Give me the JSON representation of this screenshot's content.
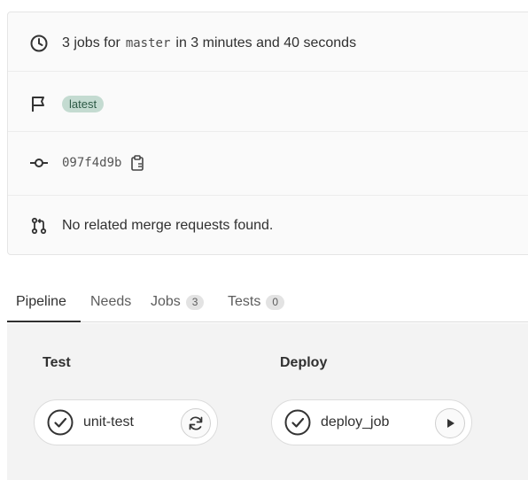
{
  "summary": {
    "jobs_prefix": "3 jobs for",
    "branch": "master",
    "duration_text": "in 3 minutes and 40 seconds",
    "badge": "latest",
    "commit_sha": "097f4d9b",
    "merge_requests_text": "No related merge requests found."
  },
  "tabs": [
    {
      "label": "Pipeline",
      "active": true
    },
    {
      "label": "Needs"
    },
    {
      "label": "Jobs",
      "count": "3"
    },
    {
      "label": "Tests",
      "count": "0"
    }
  ],
  "stages": [
    {
      "title": "Test",
      "job": {
        "name": "unit-test",
        "status": "success",
        "action": "retry"
      }
    },
    {
      "title": "Deploy",
      "job": {
        "name": "deploy_job",
        "status": "success",
        "action": "play"
      }
    }
  ],
  "icons": {
    "clock": "clock-icon",
    "flag": "flag-icon",
    "commit": "commit-icon",
    "clipboard": "clipboard-icon",
    "merge_request": "merge-request-icon",
    "status": "status-success-icon",
    "retry": "retry-icon",
    "play": "play-icon"
  },
  "colors": {
    "badge_bg": "#c4dbd1",
    "badge_text": "#2d5a46",
    "status_success": "#333333",
    "pipeline_bg": "#f3f3f3"
  }
}
